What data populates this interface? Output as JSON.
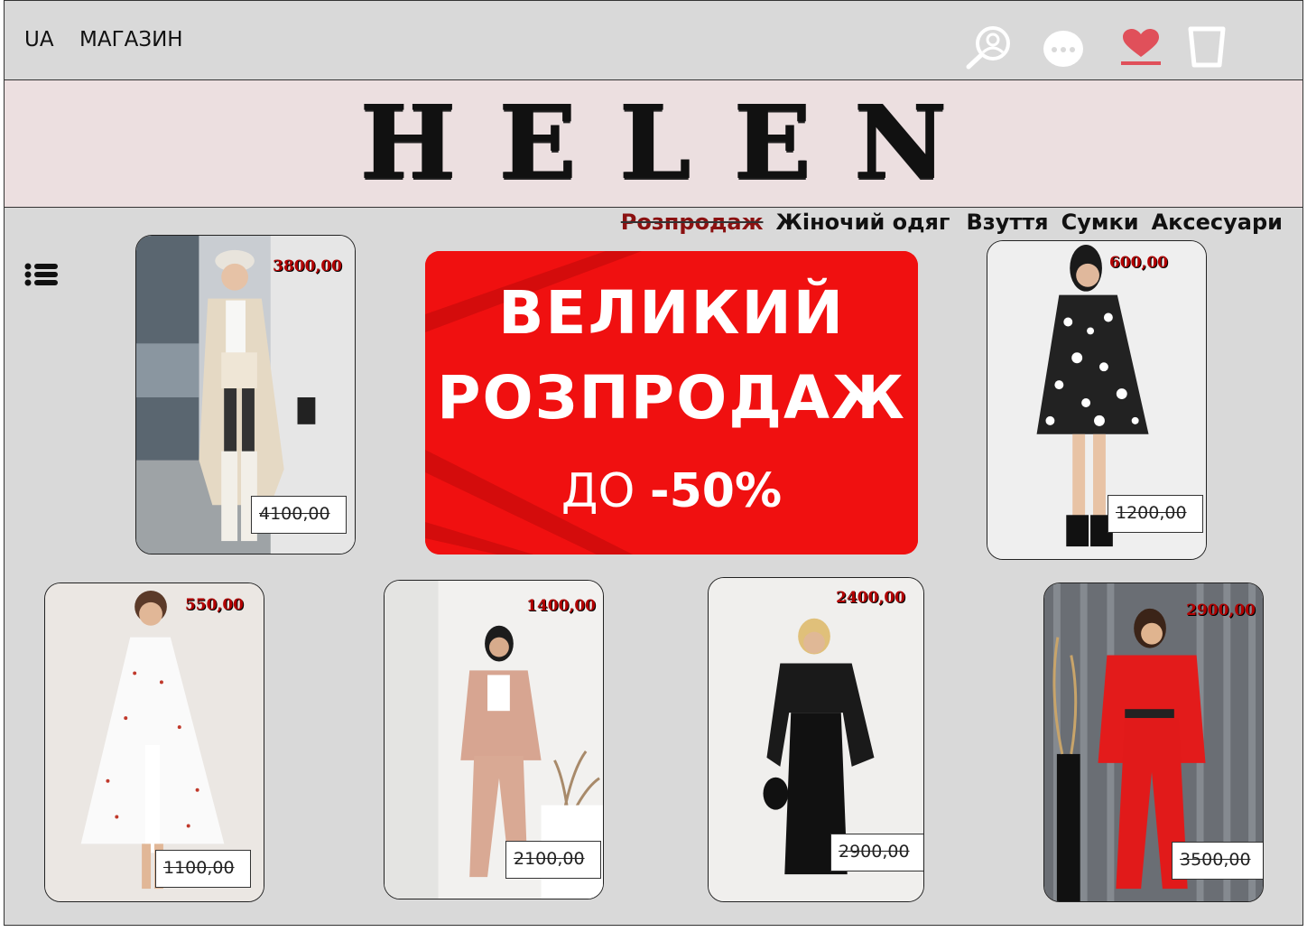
{
  "header": {
    "lang": "UA",
    "shop": "МАГАЗИН",
    "icons": [
      "search-user-icon",
      "chat-icon",
      "heart-icon",
      "cart-icon"
    ]
  },
  "logo": "HELEN",
  "nav": {
    "items": [
      "Розпродаж",
      "Жіночий одяг",
      "Взуття",
      "Сумки",
      "Аксесуари"
    ]
  },
  "banner": {
    "line1": "ВЕЛИКИЙ",
    "line2": "РОЗПРОДАЖ",
    "line3_prefix": "ДО",
    "line3_value": "-50%"
  },
  "products": [
    {
      "price": "3800,00",
      "old_price": "4100,00"
    },
    {
      "price": "600,00",
      "old_price": "1200,00"
    },
    {
      "price": "550,00",
      "old_price": "1100,00"
    },
    {
      "price": "1400,00",
      "old_price": "2100,00"
    },
    {
      "price": "2400,00",
      "old_price": "2900,00"
    },
    {
      "price": "2900,00",
      "old_price": "3500,00"
    }
  ],
  "colors": {
    "background": "#d9d9d9",
    "logo_band": "#ecdfe0",
    "accent": "#e0505a",
    "sale_red": "#f01010",
    "price_red": "#b30000"
  }
}
